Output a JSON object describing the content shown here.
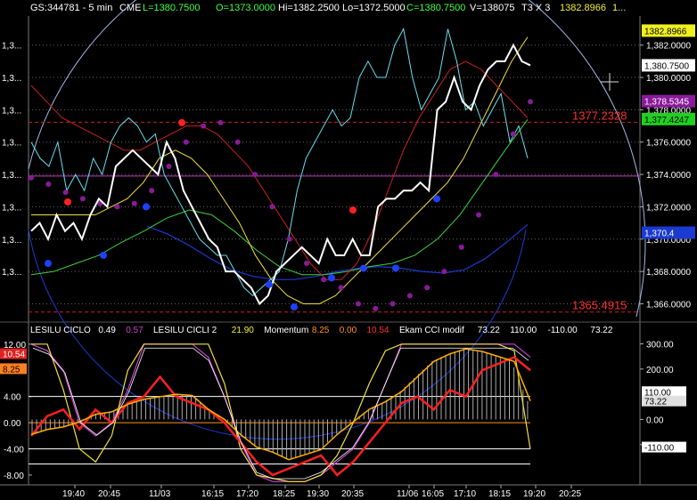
{
  "header": {
    "symbol": "GS:344781 - 5 min",
    "exchange": "CME",
    "last": "L=1380.7500",
    "open": "O=1373.0000",
    "high": "Hi=1382.2500",
    "low": "Lo=1372.5000",
    "close": "C=1380.7500",
    "volume": "V=138075",
    "mode": "T3 X 3",
    "extra": "1382.8966",
    "ellipsis": "1..."
  },
  "colors": {
    "price": "#ffffff",
    "cyan": "#66e0ee",
    "red_ma": "#cc2020",
    "yellow": "#f0e040",
    "green": "#40d040",
    "blue": "#1a3ad0",
    "purple": "#8a1a9a",
    "circle": "#9fb8e8",
    "dot_red": "#ff2020",
    "dot_blue": "#2040ff",
    "magenta_line": "#c040c0"
  },
  "main_axis": {
    "ticks": [
      "1,382.0000",
      "1,380.0000",
      "1,378.0000",
      "1,376.0000",
      "1,374.0000",
      "1,372.0000",
      "1,370.0000",
      "1,368.0000",
      "1,366.0000"
    ],
    "tick_values": [
      1382,
      1380,
      1378,
      1376,
      1374,
      1372,
      1370,
      1368,
      1366
    ],
    "left_labels": [
      "1,3...",
      "1,3...",
      "1,3...",
      "1,3...",
      "1,3...",
      "1,3...",
      "1,3...",
      "1,3..."
    ],
    "y_range": [
      1365.2,
      1383.8
    ]
  },
  "price_tags": [
    {
      "label": "1382.8966",
      "value": 1382.8966,
      "bg": "#f0f020",
      "fg": "#000000"
    },
    {
      "label": "1,380.7500",
      "value": 1380.75,
      "bg": "#ffffff",
      "fg": "#000000"
    },
    {
      "label": "1,378.5345",
      "value": 1378.5345,
      "bg": "#8a1a9a",
      "fg": "#ffffff"
    },
    {
      "label": "1,377.4247",
      "value": 1377.4247,
      "bg": "#20d020",
      "fg": "#000000"
    },
    {
      "label": "1,370.4",
      "value": 1370.4,
      "bg": "#1a3ad0",
      "fg": "#ffffff"
    }
  ],
  "levels": [
    {
      "label": "1377.2328",
      "value": 1377.2328
    },
    {
      "label": "1365.4915",
      "value": 1365.4915
    }
  ],
  "indicator": {
    "legend": [
      {
        "text": "LESILU CICLO",
        "color": "#ffffff"
      },
      {
        "text": "0.49",
        "color": "#ffffff"
      },
      {
        "text": "0.57",
        "color": "#d040d0"
      },
      {
        "text": "LESILU CICLI 2",
        "color": "#ffffff"
      },
      {
        "text": "21.90",
        "color": "#f0f040"
      },
      {
        "text": "Momentum",
        "color": "#ffffff"
      },
      {
        "text": "8.25",
        "color": "#ff9020"
      },
      {
        "text": "0.00",
        "color": "#ff9020"
      },
      {
        "text": "10.54",
        "color": "#ff3030"
      },
      {
        "text": "Ekam CCI modif",
        "color": "#ffffff"
      },
      {
        "text": "73.22",
        "color": "#ffffff"
      },
      {
        "text": "110.00",
        "color": "#ffffff"
      },
      {
        "text": "-110.00",
        "color": "#ffffff"
      },
      {
        "text": "73.22",
        "color": "#ffffff"
      }
    ],
    "left_ticks": [
      "12.00",
      "4.00",
      "0.00",
      "-4.00",
      "-8.00"
    ],
    "left_values": [
      12,
      4,
      0,
      -4,
      -8
    ],
    "left_range": [
      -9.5,
      13.2
    ],
    "left_tags": [
      {
        "label": "10.54",
        "value": 10.54,
        "bg": "#e02020",
        "fg": "#ffffff"
      },
      {
        "label": "8.25",
        "value": 8.25,
        "bg": "#ff8020",
        "fg": "#000000"
      }
    ],
    "right_ticks": [
      "300.00",
      "200.00",
      "0.00",
      "-100.00"
    ],
    "right_values": [
      300,
      200,
      0,
      -100
    ],
    "right_range": [
      -260,
      330
    ],
    "right_tags": [
      {
        "label": "110.00",
        "value": 110,
        "bg": "#ffffff",
        "fg": "#000000"
      },
      {
        "label": "73.22",
        "value": 73.22,
        "bg": "#e0e0e0",
        "fg": "#000000"
      },
      {
        "label": "-110.00",
        "value": -110,
        "bg": "#ffffff",
        "fg": "#000000"
      }
    ]
  },
  "time_axis": [
    "19:40",
    "20:45",
    "11/03",
    "16:15",
    "17:20",
    "18:25",
    "19:30",
    "20:35",
    "11/06",
    "16:05",
    "17:10",
    "18:15",
    "19:20",
    "20:25"
  ],
  "chart_data": {
    "type": "line",
    "title": "GS:344781 - 5 min",
    "x_labels": [
      "19:40",
      "20:45",
      "11/03",
      "16:15",
      "17:20",
      "18:25",
      "19:30",
      "20:35",
      "11/06",
      "16:05",
      "17:10",
      "18:15",
      "19:20",
      "20:25"
    ],
    "price_series": [
      {
        "name": "Price",
        "values": [
          1370.5,
          1371,
          1370,
          1371.5,
          1370.5,
          1371,
          1370,
          1371.5,
          1372.5,
          1372,
          1374.5,
          1375,
          1375.5,
          1375,
          1374.5,
          1374,
          1376,
          1375,
          1373,
          1372,
          1371,
          1370,
          1369.5,
          1368,
          1368,
          1367.5,
          1367,
          1366,
          1366.5,
          1368,
          1368.5,
          1369,
          1369.5,
          1369,
          1368.5,
          1370,
          1369,
          1369,
          1370,
          1369,
          1369,
          1372,
          1372.5,
          1372.5,
          1373,
          1373,
          1373.5,
          1373,
          1378,
          1378.5,
          1380,
          1378.5,
          1378,
          1379.5,
          1380.5,
          1381,
          1381,
          1382,
          1381,
          1380.75
        ]
      },
      {
        "name": "Cyan",
        "values": [
          1376,
          1375,
          1374.5,
          1376,
          1373,
          1374,
          1373,
          1375,
          1374,
          1376,
          1377,
          1377.5,
          1377,
          1376,
          1376.5,
          1374,
          1373,
          1372,
          1371,
          1370,
          1369.5,
          1369,
          1369,
          1368,
          1367,
          1366.5,
          1367,
          1367.5,
          1368,
          1370,
          1373,
          1375,
          1376,
          1377,
          1378,
          1377,
          1377.5,
          1380,
          1381,
          1380,
          1380,
          1382,
          1383,
          1380,
          1378,
          1379,
          1380,
          1383,
          1381,
          1378,
          1378.5,
          1377,
          1378,
          1379,
          1376,
          1377,
          1375
        ]
      },
      {
        "name": "Red MA",
        "values": [
          1379.5,
          1378.5,
          1377.5,
          1377,
          1376.5,
          1376,
          1375.5,
          1375.5,
          1376,
          1376.5,
          1377,
          1377,
          1376.5,
          1375.5,
          1374.5,
          1373,
          1371.5,
          1370,
          1368.5,
          1367.5,
          1367.5,
          1368.5,
          1370.5,
          1373,
          1375.5,
          1377.5,
          1379,
          1380.5,
          1381,
          1380.5,
          1379.5,
          1378.5,
          1377.5
        ]
      },
      {
        "name": "Yellow MA",
        "values": [
          1371.5,
          1371.5,
          1371.5,
          1371.5,
          1371.5,
          1372,
          1372.5,
          1373.5,
          1375,
          1375.5,
          1375,
          1374,
          1372.5,
          1371,
          1369,
          1367.5,
          1366.5,
          1366,
          1366,
          1366.5,
          1367.5,
          1368.5,
          1369.5,
          1370.5,
          1371.5,
          1372.5,
          1373.5,
          1375,
          1377,
          1379,
          1381,
          1382.5
        ]
      },
      {
        "name": "Green MA",
        "values": [
          1367.8,
          1368,
          1368.5,
          1369,
          1369.8,
          1370.5,
          1371.3,
          1371.8,
          1371.5,
          1370.5,
          1369.3,
          1368.3,
          1367.8,
          1367.8,
          1368,
          1368.3,
          1368.5,
          1369,
          1370,
          1371.5,
          1373.5,
          1375.5,
          1377.4
        ]
      },
      {
        "name": "Blue MA",
        "values": [
          1370.8,
          1370.3,
          1369.6,
          1368.8,
          1368.1,
          1367.7,
          1367.5,
          1367.5,
          1367.7,
          1368,
          1368.2,
          1368.3,
          1368.2,
          1368,
          1367.9,
          1368.1,
          1368.8,
          1369.8,
          1370.9
        ]
      },
      {
        "name": "Purple T3",
        "values": [
          1373.8,
          1373.4,
          1372.9,
          1372.5,
          1372.2,
          1372,
          1372.2,
          1373,
          1374.5,
          1376,
          1377,
          1377.2,
          1376,
          1374,
          1372,
          1370,
          1368.5,
          1367.5,
          1367,
          1366,
          1365.7,
          1366,
          1366.5,
          1367,
          1368,
          1369.5,
          1371.5,
          1374,
          1376.5,
          1378.5
        ]
      }
    ],
    "dots": {
      "red": [
        1372.3,
        1377.2,
        1371.8
      ],
      "blue": [
        1368.5,
        1369,
        1372,
        1367.2,
        1365.8,
        1367.6,
        1368.2,
        1368.2,
        1372.5
      ]
    },
    "indicator_series": [
      {
        "name": "LESILU CICLO",
        "values": [
          12,
          11,
          8,
          0,
          -2,
          0,
          5,
          12,
          12,
          12,
          12,
          10,
          4,
          -3,
          -8,
          -9,
          -9,
          -9,
          -8,
          -6,
          -4,
          0,
          6,
          12,
          12,
          12,
          12,
          12,
          12,
          12,
          12,
          10
        ]
      },
      {
        "name": "LESILU CICLI 2",
        "values": [
          12,
          12,
          5,
          -4,
          -6,
          -2,
          8,
          12,
          12,
          12,
          12,
          12,
          6,
          -4,
          -8,
          -8.5,
          -9,
          -9,
          -8,
          -5,
          0,
          6,
          11,
          12,
          12,
          12,
          12,
          12,
          12,
          12,
          11,
          -4
        ]
      },
      {
        "name": "Momentum",
        "values": [
          -2,
          1,
          2,
          -1,
          2,
          0,
          3,
          4,
          7,
          4,
          3,
          2,
          0,
          -3,
          -6,
          -8,
          -7,
          -6,
          -5,
          -8,
          -6,
          -3,
          0,
          3,
          4,
          2,
          5,
          4,
          8,
          9,
          10,
          8
        ]
      },
      {
        "name": "CCI",
        "values": [
          -60,
          -40,
          -30,
          -10,
          20,
          30,
          60,
          80,
          90,
          100,
          95,
          40,
          0,
          -60,
          -110,
          -130,
          -160,
          -140,
          -120,
          -60,
          -10,
          40,
          70,
          110,
          170,
          230,
          260,
          280,
          270,
          250,
          230,
          73.22
        ]
      }
    ]
  }
}
